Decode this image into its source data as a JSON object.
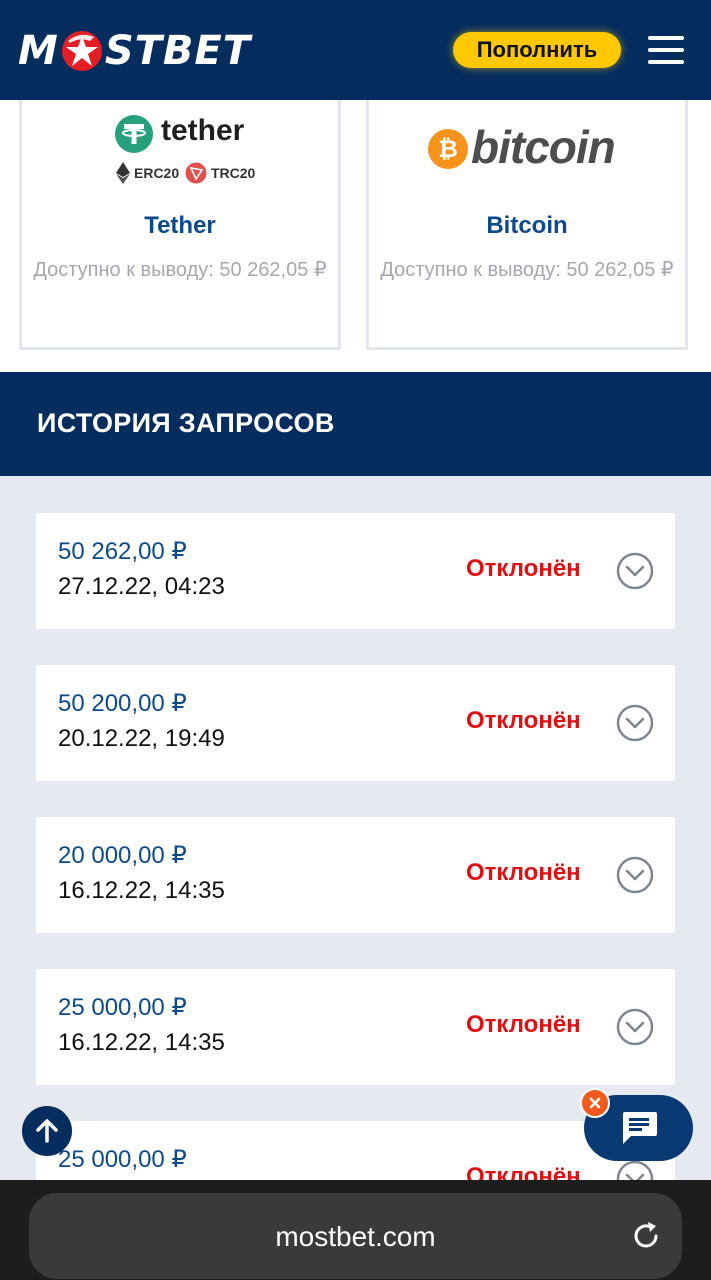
{
  "header": {
    "logo_left": "M",
    "logo_right": "STBET",
    "topup_label": "Пополнить",
    "menu_icon": "hamburger-icon"
  },
  "payment_methods": [
    {
      "name": "Tether",
      "logo_text": "tether",
      "networks": [
        "ERC20",
        "TRC20"
      ],
      "available": "Доступно к выводу: 50 262,05 ₽"
    },
    {
      "name": "Bitcoin",
      "logo_text": "bitcoin",
      "available": "Доступно к выводу: 50 262,05 ₽"
    }
  ],
  "history": {
    "title": "ИСТОРИЯ ЗАПРОСОВ",
    "items": [
      {
        "amount": "50 262,00 ₽",
        "date": "27.12.22, 04:23",
        "status": "Отклонён"
      },
      {
        "amount": "50 200,00 ₽",
        "date": "20.12.22, 19:49",
        "status": "Отклонён"
      },
      {
        "amount": "20 000,00 ₽",
        "date": "16.12.22, 14:35",
        "status": "Отклонён"
      },
      {
        "amount": "25 000,00 ₽",
        "date": "16.12.22, 14:35",
        "status": "Отклонён"
      },
      {
        "amount": "25 000,00 ₽",
        "date": "",
        "status": "Отклонён"
      }
    ]
  },
  "browser": {
    "url": "mostbet.com"
  },
  "colors": {
    "brand_navy": "#062d5e",
    "accent_yellow": "#ffc800",
    "status_red": "#e10f0f",
    "amount_blue": "#0d4a8c",
    "tether_green": "#26a17b",
    "bitcoin_orange": "#f7931a"
  }
}
